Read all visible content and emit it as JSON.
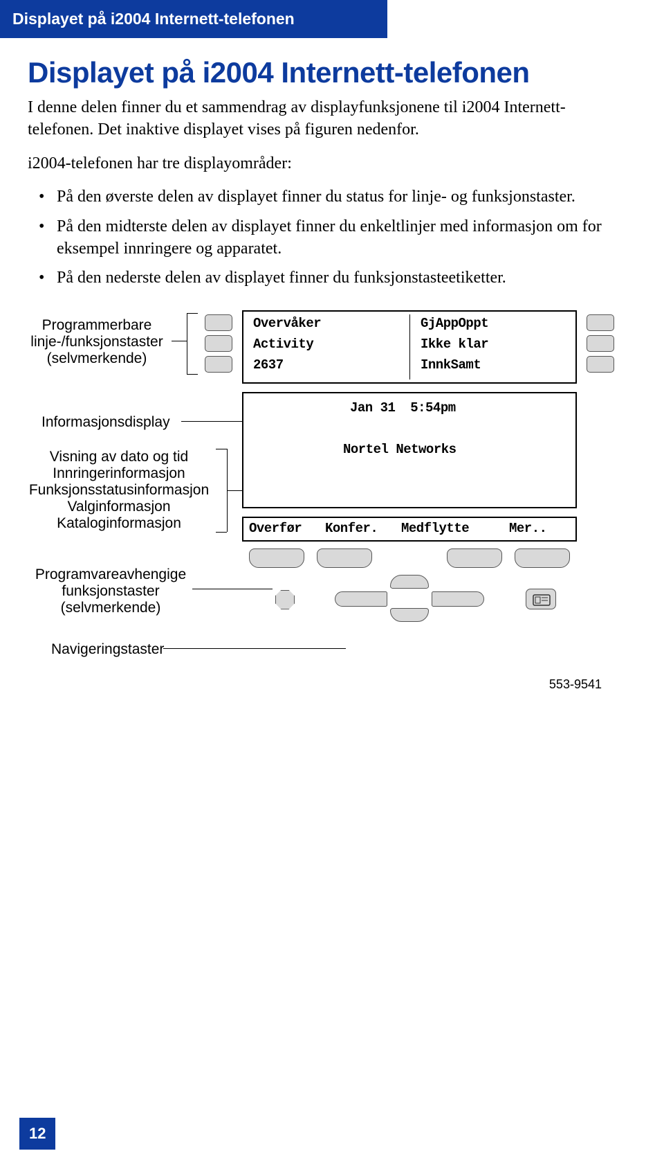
{
  "header": {
    "text": "Displayet på i2004 Internett-telefonen"
  },
  "title": "Displayet på i2004 Internett-telefonen",
  "paragraphs": {
    "p1": "I denne delen finner du et sammendrag av displayfunksjonene til i2004 Internett-telefonen. Det inaktive displayet vises på figuren nedenfor.",
    "p2": "i2004-telefonen har tre displayområder:"
  },
  "bullets": [
    "På den øverste delen av displayet finner du status for linje- og funksjonstaster.",
    "På den midterste delen av displayet finner du enkeltlinjer med informasjon om for eksempel innringere og apparatet.",
    "På den nederste delen av displayet finner du funksjonstasteetiketter."
  ],
  "callouts": {
    "lineKeys": "Programmerbare\nlinje-/funksjonstaster\n(selvmerkende)",
    "infoDisplay": "Informasjonsdisplay",
    "infoLines": "Visning av dato og tid\nInnringerinformasjon\nFunksjonsstatusinformasjon\nValginformasjon\nKataloginformasjon",
    "softkeys": "Programvareavhengige\nfunksjonstaster\n(selvmerkende)",
    "nav": "Navigeringstaster"
  },
  "display": {
    "topLeft": [
      "Overvåker",
      "Activity",
      "2637"
    ],
    "topRight": [
      "GjAppOppt",
      "Ikke klar",
      "InnkSamt"
    ],
    "mid": {
      "datetime": "Jan 31  5:54pm",
      "name": "Nortel Networks"
    },
    "soft": [
      "Overfør",
      "Konfer.",
      "Medflytte",
      "Mer.."
    ]
  },
  "figref": "553-9541",
  "pageNumber": "12"
}
